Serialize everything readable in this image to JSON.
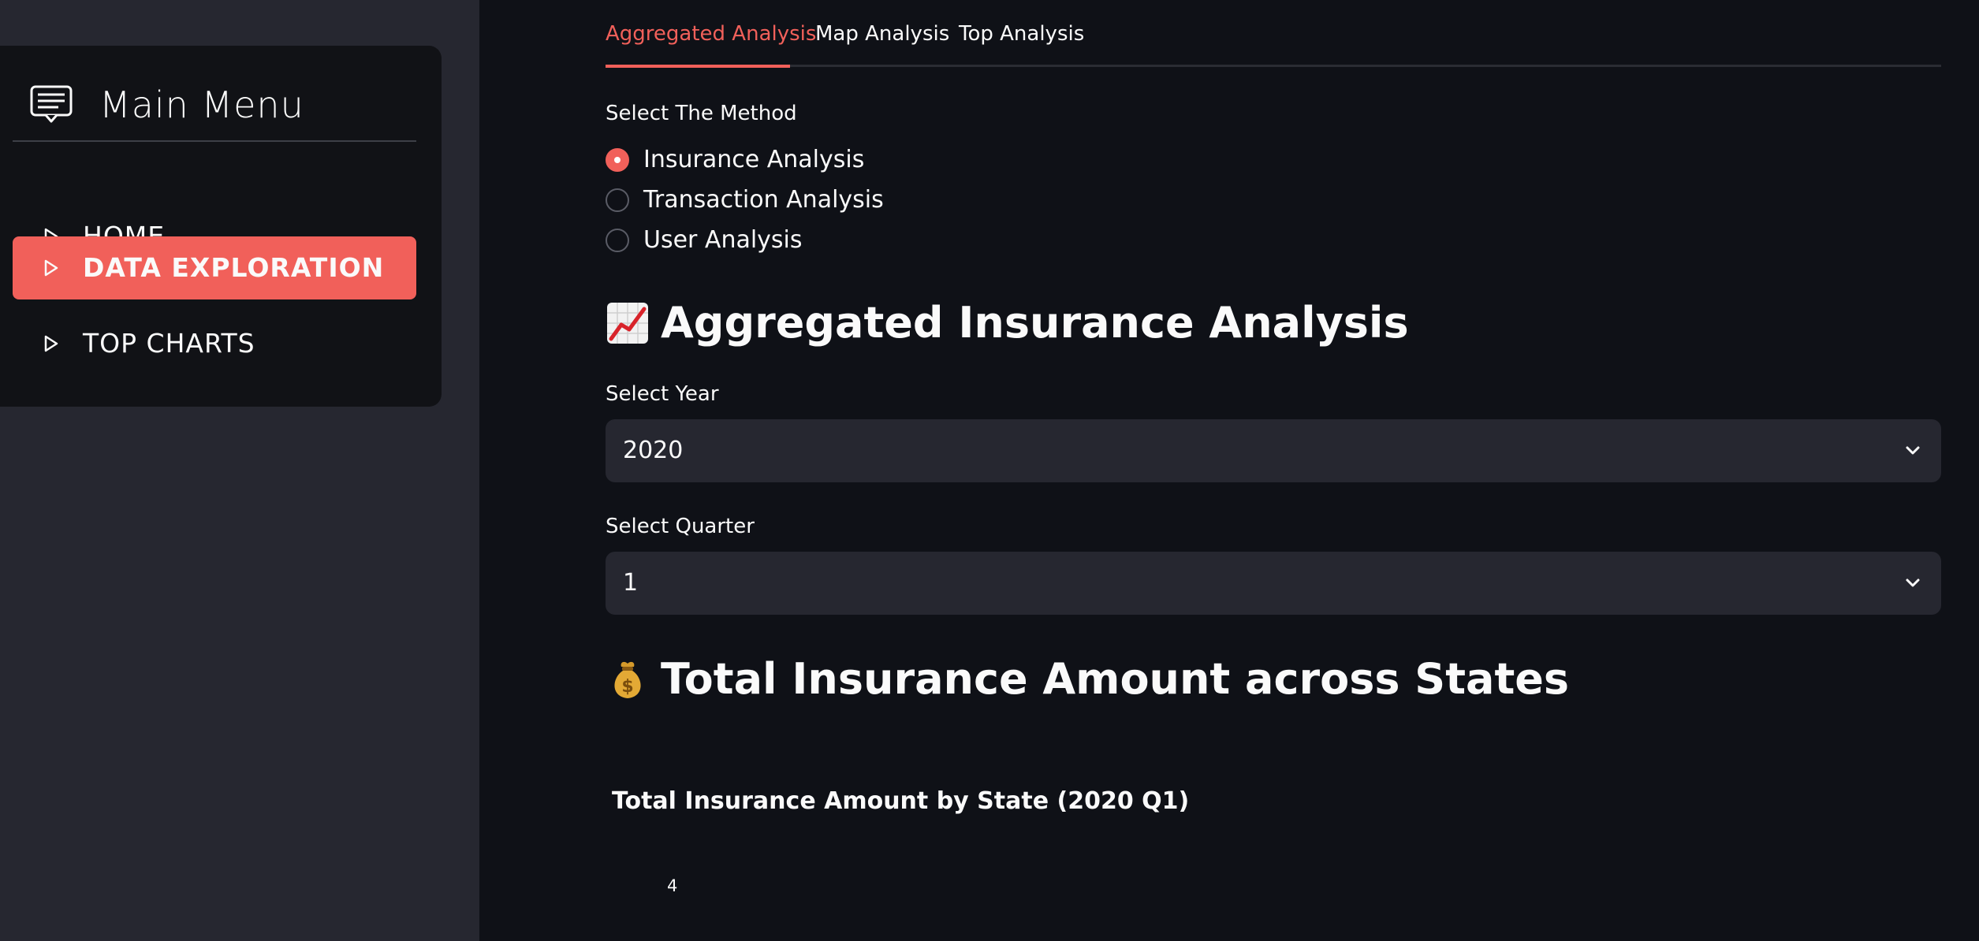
{
  "sidebar": {
    "title": "Main Menu",
    "items": [
      {
        "label": "HOME",
        "active": false
      },
      {
        "label": "DATA EXPLORATION",
        "active": true
      },
      {
        "label": "TOP CHARTS",
        "active": false
      }
    ]
  },
  "tabs": [
    {
      "label": "Aggregated Analysis",
      "active": true
    },
    {
      "label": "Map Analysis",
      "active": false
    },
    {
      "label": "Top Analysis",
      "active": false
    }
  ],
  "method": {
    "label": "Select The Method",
    "options": [
      "Insurance Analysis",
      "Transaction Analysis",
      "User Analysis"
    ],
    "selected": "Insurance Analysis"
  },
  "section_heading": "Aggregated Insurance Analysis",
  "year_select": {
    "label": "Select Year",
    "value": "2020"
  },
  "quarter_select": {
    "label": "Select Quarter",
    "value": "1"
  },
  "chart_heading": "Total Insurance Amount across States",
  "chart_data": {
    "type": "bar",
    "title": "Total Insurance Amount by State (2020 Q1)",
    "visible_y_ticks": [
      "4"
    ]
  },
  "colors": {
    "accent": "#f1605a",
    "background": "#0f1117",
    "sidebar": "#262730",
    "menu_card": "#111216",
    "input_bg": "#262730"
  },
  "icons": {
    "menu": "menu-card-icon",
    "nav": "play-triangle-icon",
    "chevron": "chevron-down-icon",
    "chart_up": "chart-increasing-emoji",
    "money_bag": "money-bag-emoji"
  }
}
